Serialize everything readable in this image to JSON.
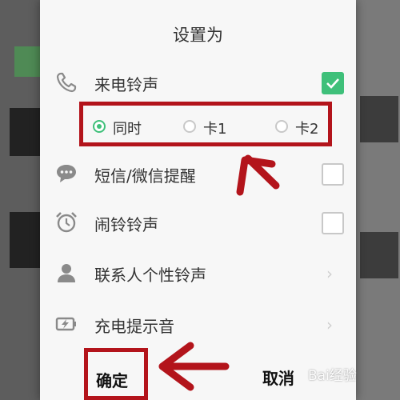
{
  "dialog": {
    "title": "设置为",
    "items": [
      {
        "label": "来电铃声",
        "control": "checkbox",
        "checked": true,
        "icon": "phone-icon"
      },
      {
        "label": "短信/微信提醒",
        "control": "checkbox",
        "checked": false,
        "icon": "message-bubble-icon"
      },
      {
        "label": "闹铃铃声",
        "control": "checkbox",
        "checked": false,
        "icon": "alarm-clock-icon"
      },
      {
        "label": "联系人个性铃声",
        "control": "chevron",
        "icon": "contact-person-icon"
      },
      {
        "label": "充电提示音",
        "control": "chevron",
        "icon": "battery-charging-icon"
      }
    ],
    "sim_options": [
      {
        "label": "同时",
        "selected": true
      },
      {
        "label": "卡1",
        "selected": false
      },
      {
        "label": "卡2",
        "selected": false
      }
    ],
    "confirm_label": "确定",
    "cancel_label": "取消"
  },
  "watermark": "Bai经验",
  "colors": {
    "accent": "#3fc07a",
    "highlight": "#b3141b"
  }
}
